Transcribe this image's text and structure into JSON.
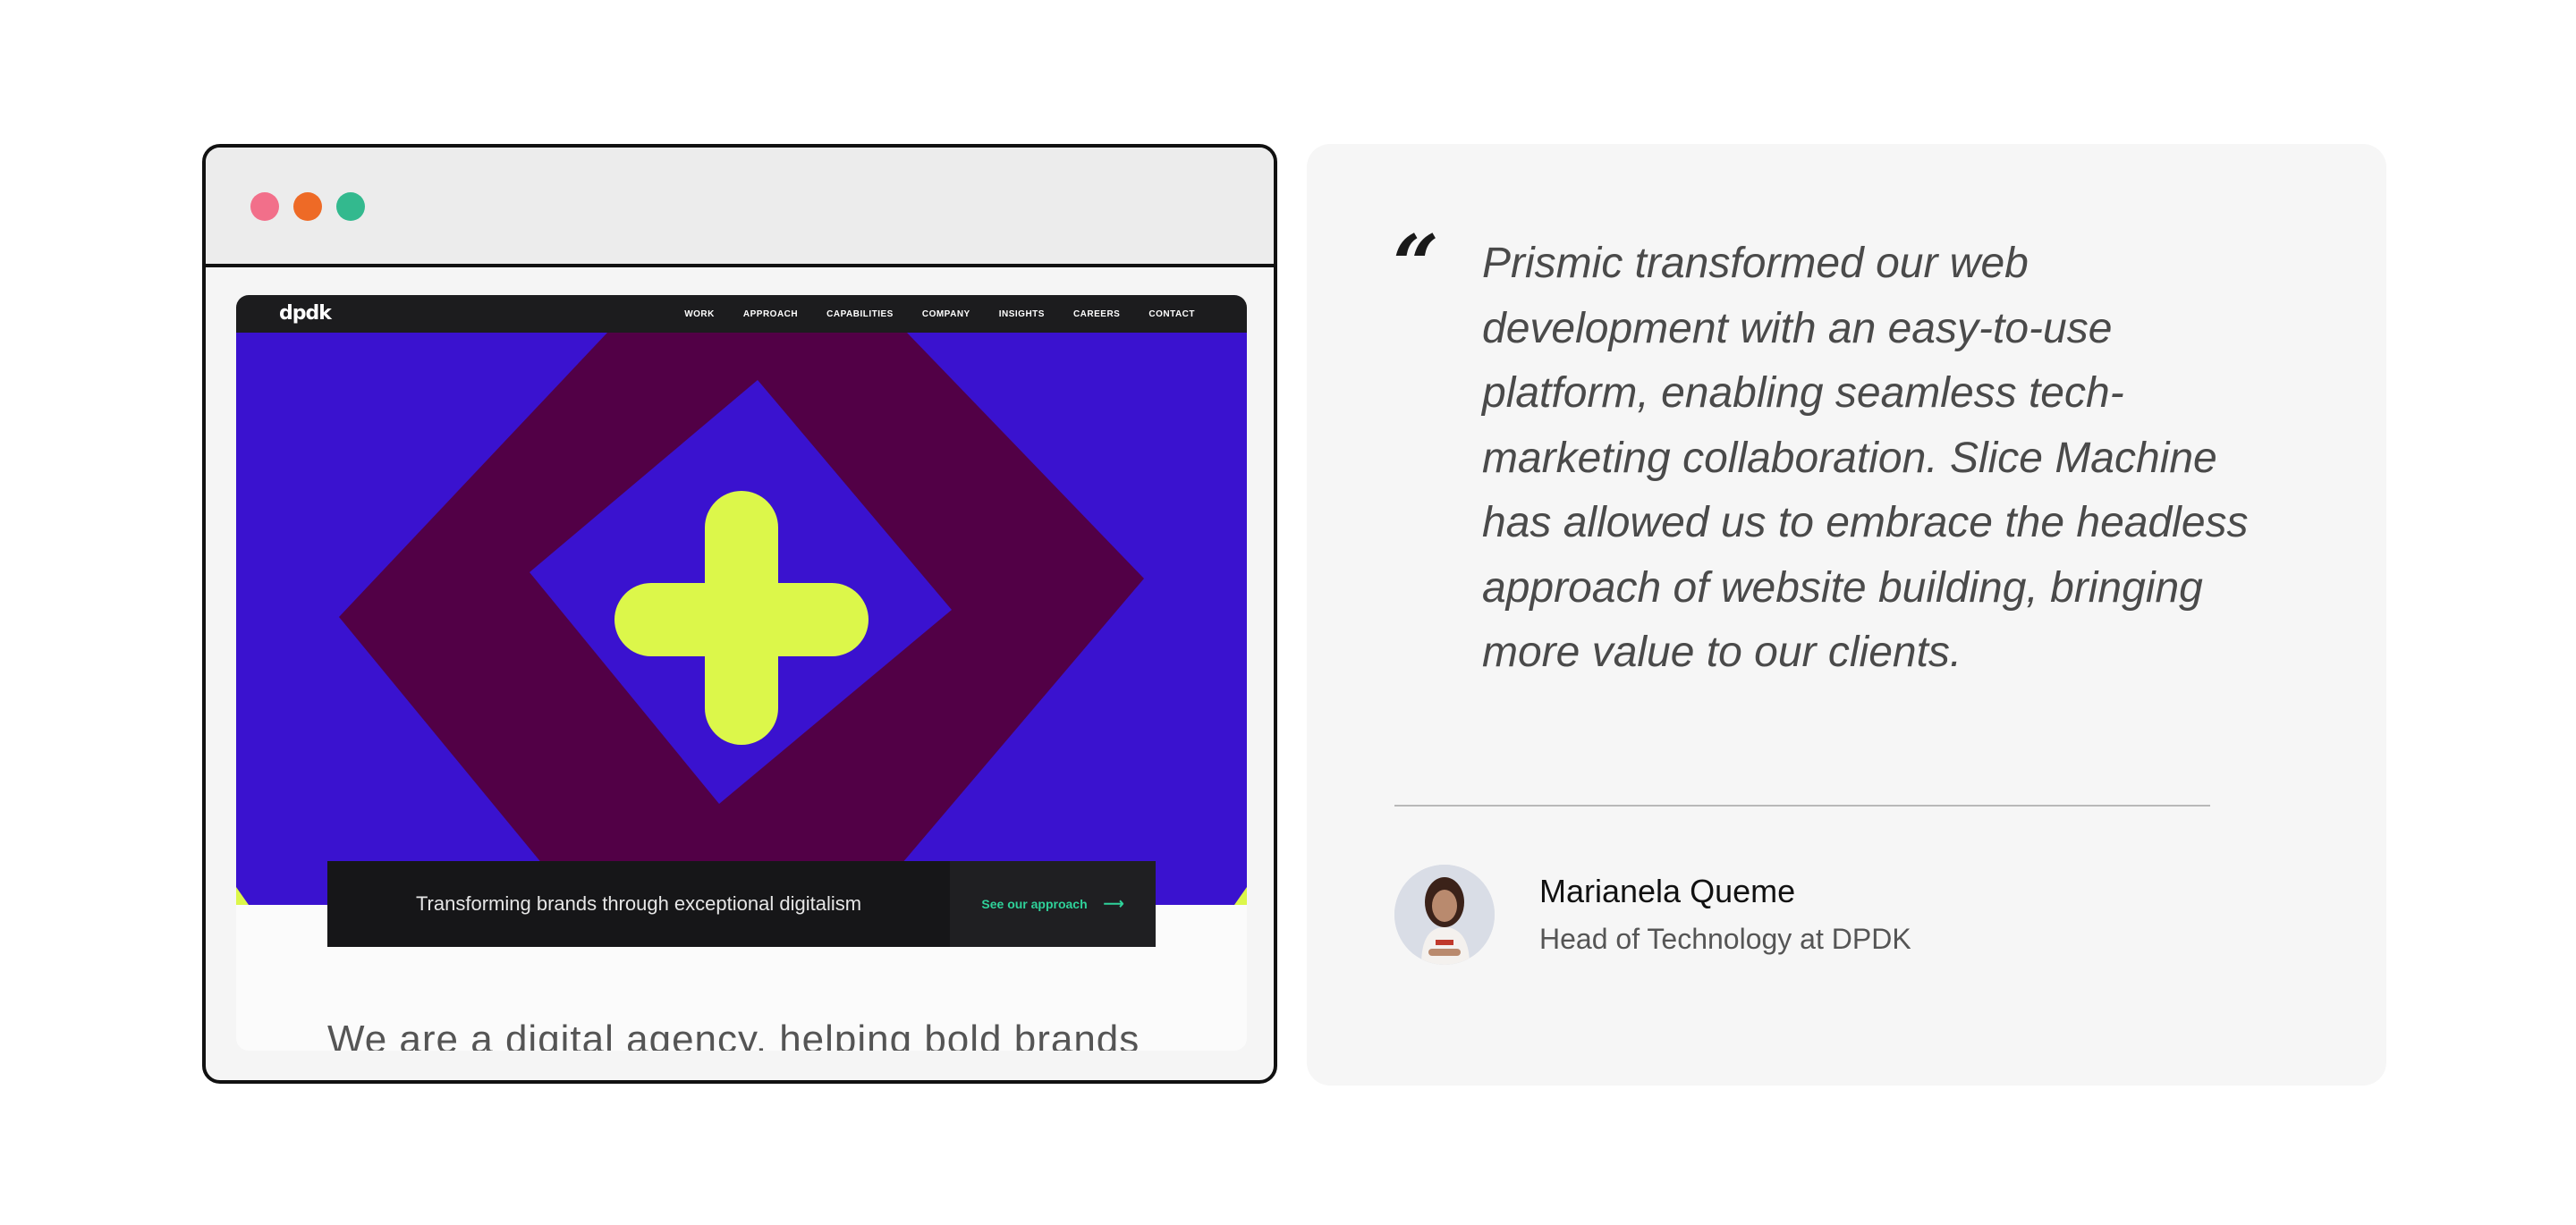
{
  "browser": {
    "dots": [
      {
        "name": "close",
        "color": "#f26f8a"
      },
      {
        "name": "minimize",
        "color": "#ee6a26"
      },
      {
        "name": "maximize",
        "color": "#33b98e"
      }
    ]
  },
  "site": {
    "logo": "dpdk",
    "nav": [
      "WORK",
      "APPROACH",
      "CAPABILITIES",
      "COMPANY",
      "INSIGHTS",
      "CAREERS",
      "CONTACT"
    ],
    "hero_colors": {
      "background": "#3a12cf",
      "diamond": "#520046",
      "plus": "#dcf74a"
    },
    "cta_text": "Transforming brands through exceptional digitalism",
    "cta_link": "See our approach",
    "cta_arrow": "⟶",
    "body_text": "We are a digital agency, helping bold brands"
  },
  "testimonial": {
    "quote_mark": "“",
    "quote": "Prismic transformed our web development with an easy-to-use platform, enabling seamless tech-marketing collaboration. Slice Machine has allowed us to embrace the headless approach of website building, bringing more value to our clients.",
    "author_name": "Marianela Queme",
    "author_role": "Head of Technology at DPDK"
  }
}
